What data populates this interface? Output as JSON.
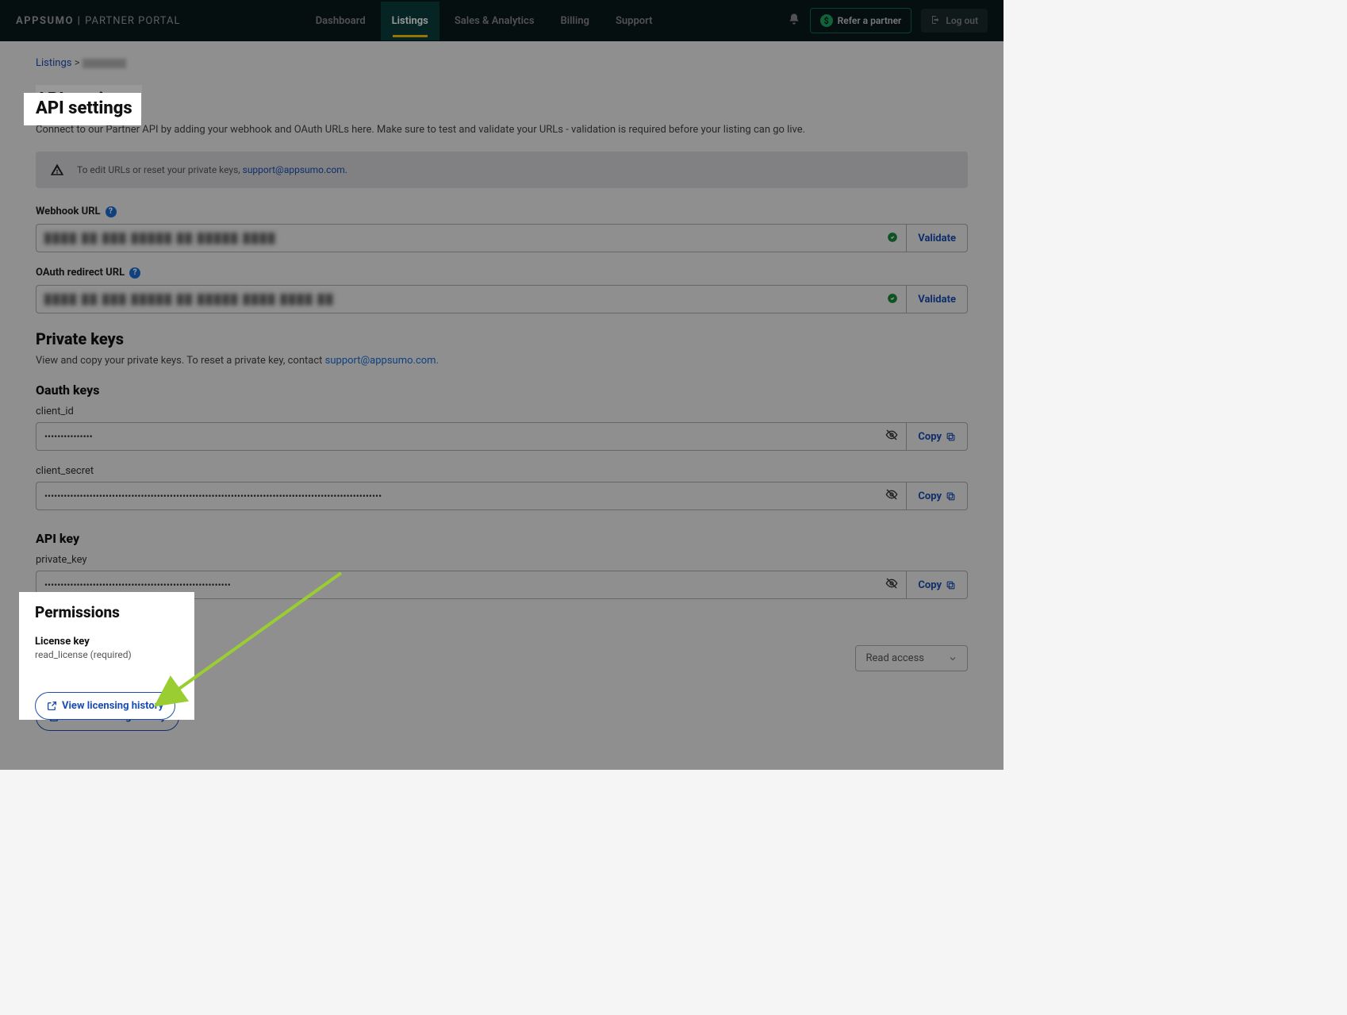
{
  "brand": {
    "app": "APPSUMO",
    "sep": "|",
    "portal": "PARTNER PORTAL"
  },
  "nav": {
    "dashboard": "Dashboard",
    "listings": "Listings",
    "sales": "Sales & Analytics",
    "billing": "Billing",
    "support": "Support"
  },
  "top": {
    "refer": "Refer a partner",
    "logout": "Log out"
  },
  "breadcrumb": {
    "listings": "Listings",
    "sep": ">"
  },
  "page": {
    "title": "API settings",
    "sub": "Connect to our Partner API by adding your webhook and OAuth URLs here. Make sure to test and validate your URLs - validation is required before your listing can go live."
  },
  "alert": {
    "text": "To edit URLs or reset your private keys, ",
    "email": "support@appsumo.com."
  },
  "fields": {
    "webhook_label": "Webhook URL",
    "oauth_label": "OAuth redirect URL",
    "validate": "Validate"
  },
  "private_keys": {
    "heading": "Private keys",
    "sub_pre": "View and copy your private keys. To reset a private key, contact ",
    "email": "support@appsumo.com."
  },
  "oauth_keys": {
    "heading": "Oauth keys",
    "client_id_label": "client_id",
    "client_id_value": "•••••••••••••••",
    "client_secret_label": "client_secret",
    "client_secret_value": "•••••••••••••••••••••••••••••••••••••••••••••••••••••••••••••••••••••••••••••••••••••••••••••••••••••••••",
    "copy": "Copy"
  },
  "api_key": {
    "heading": "API key",
    "private_key_label": "private_key",
    "private_key_value": "••••••••••••••••••••••••••••••••••••••••••••••••••••••••••"
  },
  "permissions": {
    "heading": "Permissions",
    "license_title": "License key",
    "license_desc": "read_license (required)",
    "read_access": "Read access",
    "view_history": "View licensing history"
  }
}
